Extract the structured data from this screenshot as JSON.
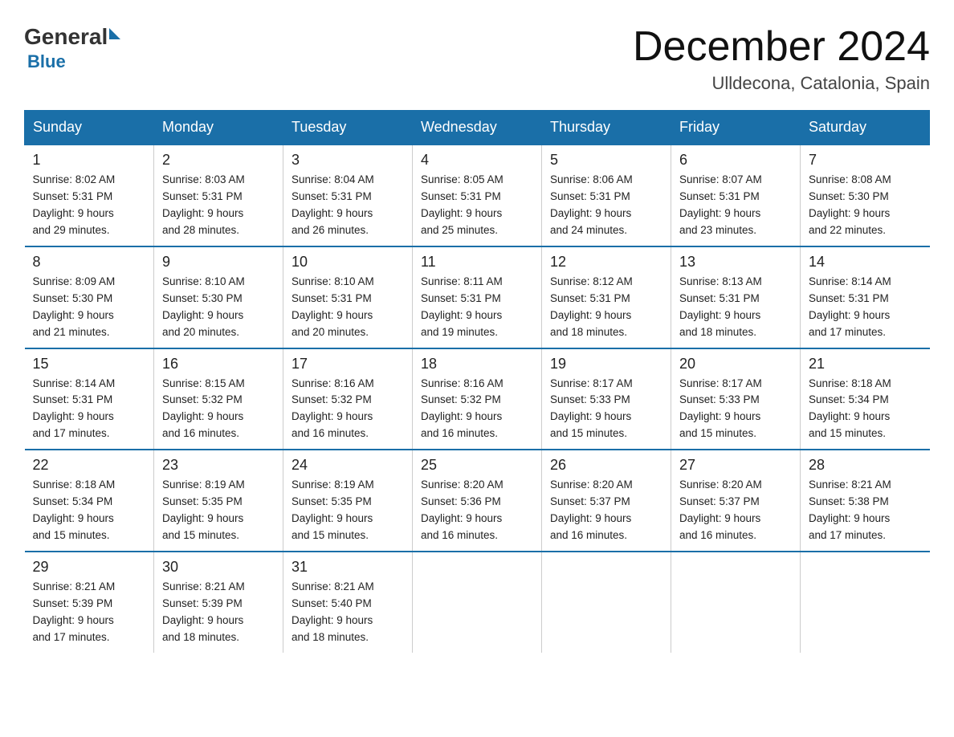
{
  "logo": {
    "general": "General",
    "blue": "Blue",
    "triangle": "▶"
  },
  "title": "December 2024",
  "subtitle": "Ulldecona, Catalonia, Spain",
  "headers": [
    "Sunday",
    "Monday",
    "Tuesday",
    "Wednesday",
    "Thursday",
    "Friday",
    "Saturday"
  ],
  "weeks": [
    [
      {
        "day": "1",
        "sunrise": "8:02 AM",
        "sunset": "5:31 PM",
        "daylight": "9 hours and 29 minutes."
      },
      {
        "day": "2",
        "sunrise": "8:03 AM",
        "sunset": "5:31 PM",
        "daylight": "9 hours and 28 minutes."
      },
      {
        "day": "3",
        "sunrise": "8:04 AM",
        "sunset": "5:31 PM",
        "daylight": "9 hours and 26 minutes."
      },
      {
        "day": "4",
        "sunrise": "8:05 AM",
        "sunset": "5:31 PM",
        "daylight": "9 hours and 25 minutes."
      },
      {
        "day": "5",
        "sunrise": "8:06 AM",
        "sunset": "5:31 PM",
        "daylight": "9 hours and 24 minutes."
      },
      {
        "day": "6",
        "sunrise": "8:07 AM",
        "sunset": "5:31 PM",
        "daylight": "9 hours and 23 minutes."
      },
      {
        "day": "7",
        "sunrise": "8:08 AM",
        "sunset": "5:30 PM",
        "daylight": "9 hours and 22 minutes."
      }
    ],
    [
      {
        "day": "8",
        "sunrise": "8:09 AM",
        "sunset": "5:30 PM",
        "daylight": "9 hours and 21 minutes."
      },
      {
        "day": "9",
        "sunrise": "8:10 AM",
        "sunset": "5:30 PM",
        "daylight": "9 hours and 20 minutes."
      },
      {
        "day": "10",
        "sunrise": "8:10 AM",
        "sunset": "5:31 PM",
        "daylight": "9 hours and 20 minutes."
      },
      {
        "day": "11",
        "sunrise": "8:11 AM",
        "sunset": "5:31 PM",
        "daylight": "9 hours and 19 minutes."
      },
      {
        "day": "12",
        "sunrise": "8:12 AM",
        "sunset": "5:31 PM",
        "daylight": "9 hours and 18 minutes."
      },
      {
        "day": "13",
        "sunrise": "8:13 AM",
        "sunset": "5:31 PM",
        "daylight": "9 hours and 18 minutes."
      },
      {
        "day": "14",
        "sunrise": "8:14 AM",
        "sunset": "5:31 PM",
        "daylight": "9 hours and 17 minutes."
      }
    ],
    [
      {
        "day": "15",
        "sunrise": "8:14 AM",
        "sunset": "5:31 PM",
        "daylight": "9 hours and 17 minutes."
      },
      {
        "day": "16",
        "sunrise": "8:15 AM",
        "sunset": "5:32 PM",
        "daylight": "9 hours and 16 minutes."
      },
      {
        "day": "17",
        "sunrise": "8:16 AM",
        "sunset": "5:32 PM",
        "daylight": "9 hours and 16 minutes."
      },
      {
        "day": "18",
        "sunrise": "8:16 AM",
        "sunset": "5:32 PM",
        "daylight": "9 hours and 16 minutes."
      },
      {
        "day": "19",
        "sunrise": "8:17 AM",
        "sunset": "5:33 PM",
        "daylight": "9 hours and 15 minutes."
      },
      {
        "day": "20",
        "sunrise": "8:17 AM",
        "sunset": "5:33 PM",
        "daylight": "9 hours and 15 minutes."
      },
      {
        "day": "21",
        "sunrise": "8:18 AM",
        "sunset": "5:34 PM",
        "daylight": "9 hours and 15 minutes."
      }
    ],
    [
      {
        "day": "22",
        "sunrise": "8:18 AM",
        "sunset": "5:34 PM",
        "daylight": "9 hours and 15 minutes."
      },
      {
        "day": "23",
        "sunrise": "8:19 AM",
        "sunset": "5:35 PM",
        "daylight": "9 hours and 15 minutes."
      },
      {
        "day": "24",
        "sunrise": "8:19 AM",
        "sunset": "5:35 PM",
        "daylight": "9 hours and 15 minutes."
      },
      {
        "day": "25",
        "sunrise": "8:20 AM",
        "sunset": "5:36 PM",
        "daylight": "9 hours and 16 minutes."
      },
      {
        "day": "26",
        "sunrise": "8:20 AM",
        "sunset": "5:37 PM",
        "daylight": "9 hours and 16 minutes."
      },
      {
        "day": "27",
        "sunrise": "8:20 AM",
        "sunset": "5:37 PM",
        "daylight": "9 hours and 16 minutes."
      },
      {
        "day": "28",
        "sunrise": "8:21 AM",
        "sunset": "5:38 PM",
        "daylight": "9 hours and 17 minutes."
      }
    ],
    [
      {
        "day": "29",
        "sunrise": "8:21 AM",
        "sunset": "5:39 PM",
        "daylight": "9 hours and 17 minutes."
      },
      {
        "day": "30",
        "sunrise": "8:21 AM",
        "sunset": "5:39 PM",
        "daylight": "9 hours and 18 minutes."
      },
      {
        "day": "31",
        "sunrise": "8:21 AM",
        "sunset": "5:40 PM",
        "daylight": "9 hours and 18 minutes."
      },
      null,
      null,
      null,
      null
    ]
  ],
  "label_sunrise": "Sunrise:",
  "label_sunset": "Sunset:",
  "label_daylight": "Daylight:"
}
